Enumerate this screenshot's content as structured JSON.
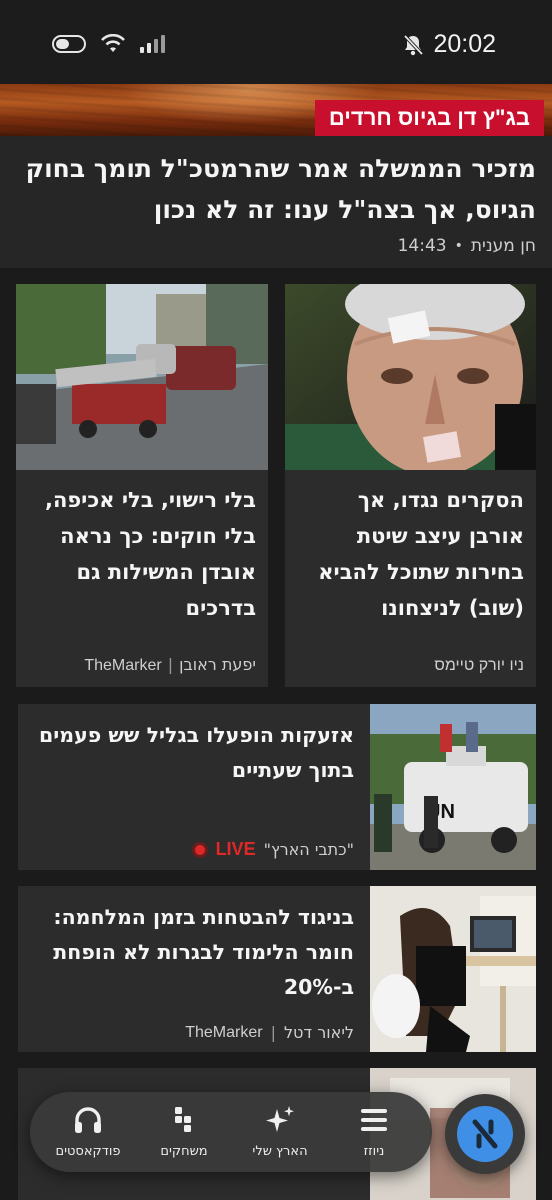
{
  "status_bar": {
    "time": "20:02"
  },
  "hero": {
    "tag": "בג\"ץ דן בגיוס חרדים",
    "title": "מזכיר הממשלה אמר שהרמטכ\"ל תומך בחוק הגיוס, אך בצה\"ל ענו: זה לא נכון",
    "author": "חן מענית",
    "time": "14:43"
  },
  "grid_cards": [
    {
      "title": "הסקרים נגדו, אך אורבן עיצב שיטת בחירות שתוכל להביא (שוב) לניצחונו",
      "source": "ניו יורק טיימס"
    },
    {
      "title": "בלי רישוי, בלי אכיפה, בלי חוקים: כך נראה אובדן המשילות גם בדרכים",
      "author": "יפעת ראובן",
      "source": "TheMarker"
    }
  ],
  "wide_cards": [
    {
      "title": "אזעקות הופעלו בגליל שש פעמים בתוך שעתיים",
      "live_label": "LIVE",
      "author": "\"כתבי הארץ\""
    },
    {
      "title": "בניגוד להבטחות בזמן המלחמה: חומר הלימוד לבגרות לא הופחת ב-20%",
      "author": "ליאור דטל",
      "source": "TheMarker"
    },
    {
      "title": "",
      "author": ""
    }
  ],
  "bottom_nav": {
    "items": [
      {
        "label": "ניוזז",
        "icon": "menu-icon"
      },
      {
        "label": "הארץ שלי",
        "icon": "sparkle-icon"
      },
      {
        "label": "משחקים",
        "icon": "games-icon"
      },
      {
        "label": "פודקאסטים",
        "icon": "headphones-icon"
      }
    ],
    "fab_icon": "haaretz-logo-icon"
  },
  "colors": {
    "accent_red": "#c8102e",
    "live_red": "#e02828",
    "fab_blue": "#3f8fe6"
  }
}
